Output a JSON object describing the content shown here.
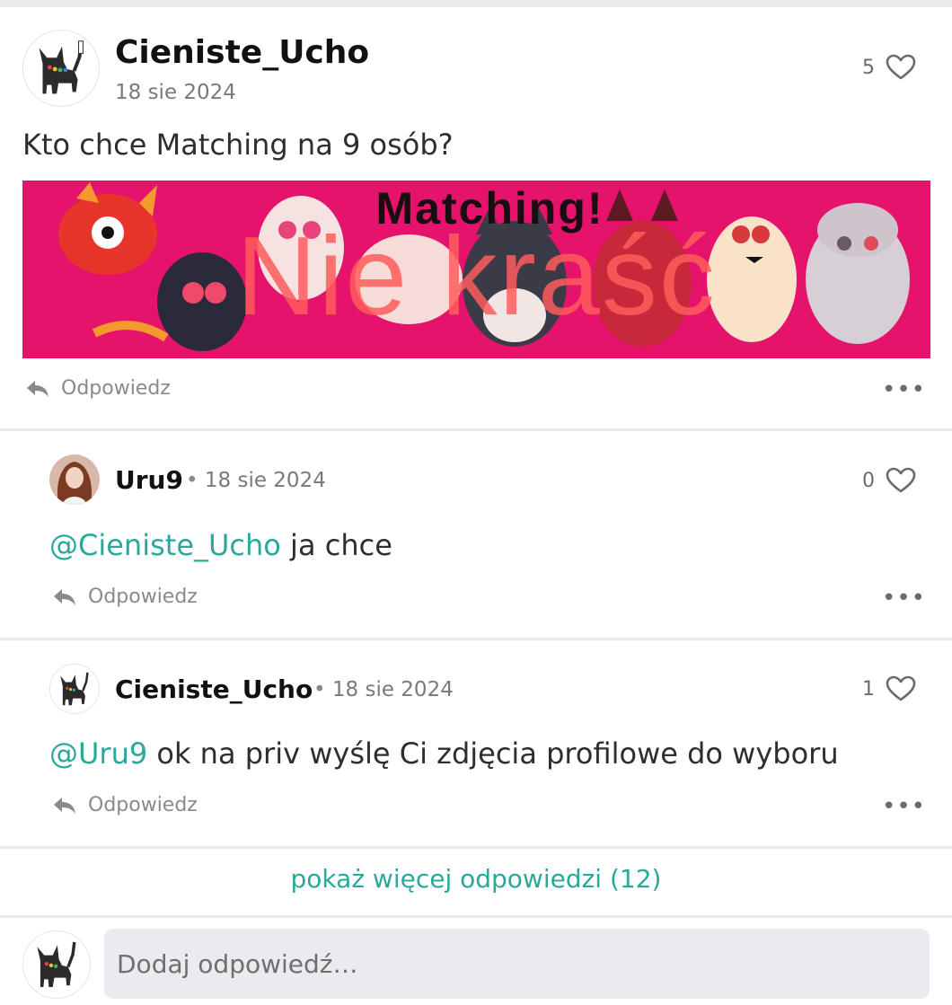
{
  "post": {
    "author": "Cieniste_Ucho",
    "date": "18 sie 2024",
    "likes": "5",
    "text": "Kto chce Matching na 9 osób?",
    "image": {
      "title_text": "Matching!",
      "watermark_text": "Nie kraść",
      "background_color": "#e5136b"
    },
    "reply_label": "Odpowiedz",
    "more_label": "•••"
  },
  "replies": [
    {
      "author": "Uru9",
      "separator": "•",
      "date": "18 sie 2024",
      "likes": "0",
      "mention": "@Cieniste_Ucho",
      "text": " ja chce",
      "reply_label": "Odpowiedz",
      "more_label": "•••"
    },
    {
      "author": "Cieniste_Ucho",
      "separator": "•",
      "date": "18 sie 2024",
      "likes": "1",
      "mention": "@Uru9",
      "text": " ok na priv wyślę Ci zdjęcia profilowe do wyboru",
      "reply_label": "Odpowiedz",
      "more_label": "•••"
    }
  ],
  "show_more": "pokaż więcej odpowiedzi (12)",
  "composer": {
    "placeholder": "Dodaj odpowiedź…"
  },
  "colors": {
    "accent": "#2aa99b",
    "banner": "#e5136b"
  },
  "icons": [
    "heart-icon",
    "reply-arrow-icon",
    "more-dots-icon",
    "cat-avatar-icon",
    "user-avatar-icon"
  ]
}
